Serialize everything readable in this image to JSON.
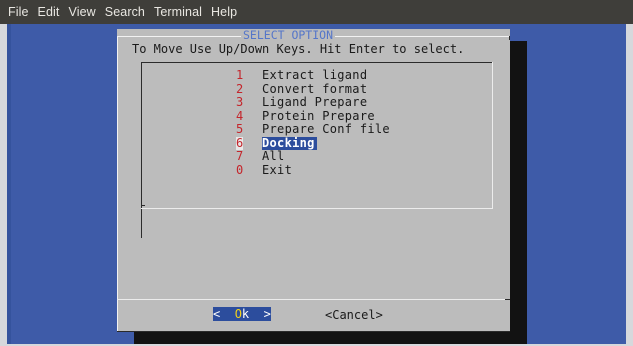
{
  "menubar": {
    "items": [
      "File",
      "Edit",
      "View",
      "Search",
      "Terminal",
      "Help"
    ]
  },
  "dialog": {
    "title": "SELECT OPTION",
    "instruction": "To Move Use Up/Down Keys. Hit Enter to select.",
    "options": [
      {
        "number": "1",
        "label": "Extract ligand",
        "selected": false
      },
      {
        "number": "2",
        "label": "Convert format",
        "selected": false
      },
      {
        "number": "3",
        "label": "Ligand Prepare",
        "selected": false
      },
      {
        "number": "4",
        "label": "Protein Prepare",
        "selected": false
      },
      {
        "number": "5",
        "label": "Prepare Conf file",
        "selected": false
      },
      {
        "number": "6",
        "label": "Docking",
        "selected": true
      },
      {
        "number": "7",
        "label": "All",
        "selected": false
      },
      {
        "number": "0",
        "label": "Exit",
        "selected": false
      }
    ],
    "ok_button": {
      "left": "<",
      "hotkey": "O",
      "rest": "k",
      "right": ">"
    },
    "cancel_button": "<Cancel>"
  },
  "colors": {
    "terminal_bg": "#3e5ba8",
    "dialog_bg": "#bcbcbc",
    "title": "#5576c9",
    "number": "#c4252b",
    "selection": "#2c4d9d",
    "hotkey": "#f2d21b",
    "menubar_bg": "#3f3e3a"
  }
}
